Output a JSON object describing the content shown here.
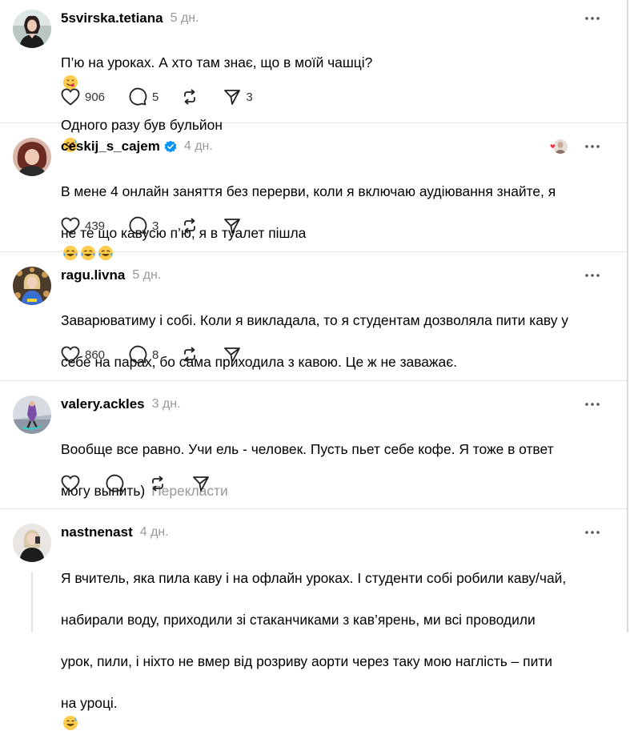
{
  "colors": {
    "text": "#000000",
    "muted": "#999999",
    "divider": "#e5e5e5",
    "verified": "#0095f6",
    "like_heart": "#ff3040"
  },
  "posts": [
    {
      "username": "5svirska.tetiana",
      "time": "5 дн.",
      "lines": [
        "П’ю на уроках. А хто там знає, що в моїй чашці?",
        "Одного разу був бульйон"
      ],
      "emoji": [
        "savoring-face-emoji",
        "sweat-smile-emoji"
      ],
      "likes": "906",
      "replies": "5",
      "shares": "3"
    },
    {
      "username": "ceskij_s_cajem",
      "verified": true,
      "time": "4 дн.",
      "lines": [
        "В мене 4 онлайн заняття без перерви, коли я включаю аудіювання знайте, я",
        "не те що кавусю п’ю, я в туалет пішла"
      ],
      "emoji": [
        "tears-of-joy-emoji",
        "tears-of-joy-emoji",
        "tears-of-joy-emoji"
      ],
      "likes": "439",
      "replies": "3"
    },
    {
      "username": "ragu.livna",
      "time": "5 дн.",
      "lines": [
        "Заварюватиму і собі. Коли я викладала, то я студентам дозволяла пити каву у",
        "себе на парах, бо сама приходила з кавою. Це ж не заважає."
      ],
      "likes": "860",
      "replies": "8"
    },
    {
      "username": "valery.ackles",
      "time": "3 дн.",
      "lines": [
        "Вообще все равно. Учи ель - человек. Пусть пьет себе кофе. Я тоже в ответ",
        "могу выпить)"
      ],
      "translate": "Перекласти"
    },
    {
      "username": "nastnenast",
      "time": "4 дн.",
      "lines": [
        "Я вчитель, яка пила каву і на офлайн уроках. І студенти собі робили каву/чай,",
        "набирали воду, приходили зі стаканчиками з кав’ярень, ми всі проводили",
        "урок, пили, і ніхто не вмер від розриву аорти через таку мою наглість – пити",
        "на уроці."
      ],
      "emoji": [
        "sweat-smile-emoji"
      ]
    }
  ],
  "icons": {
    "like": "heart-icon",
    "reply": "comment-icon",
    "repost": "repost-icon",
    "share": "send-icon",
    "more": "more-dots-icon"
  }
}
